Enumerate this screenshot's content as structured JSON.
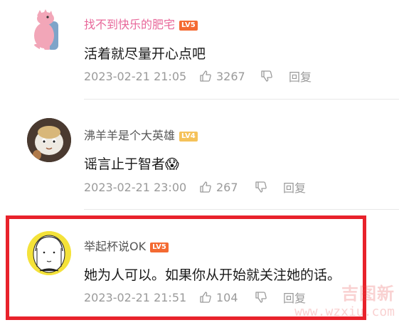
{
  "colors": {
    "username_pink": "#e8689a",
    "username_gray": "#555555",
    "badge_red": "#f46a32",
    "badge_yellow": "#f5c25a",
    "highlight": "#e8222b"
  },
  "comments": [
    {
      "username": "找不到快乐的肥宅",
      "level": "LV5",
      "text": "活着就尽量开心点吧",
      "time": "2023-02-21 21:05",
      "likes": "3267",
      "reply_label": "回复",
      "avatar_icon": "pink-dinosaur-avatar"
    },
    {
      "username": "沸羊羊是个大英雄",
      "level": "LV4",
      "text": "谣言止于智者",
      "emoji": "😱",
      "time": "2023-02-21 23:00",
      "likes": "267",
      "reply_label": "回复",
      "avatar_icon": "sheep-avatar"
    },
    {
      "username": "举起杯说OK",
      "level": "LV5",
      "text": "她为人可以。如果你从开始就关注她的话。",
      "time": "2023-02-21 21:51",
      "likes": "104",
      "reply_label": "回复",
      "avatar_icon": "sketch-girl-avatar"
    }
  ],
  "watermark": {
    "title": "吉图新",
    "url": "www.wzxiu.com"
  }
}
